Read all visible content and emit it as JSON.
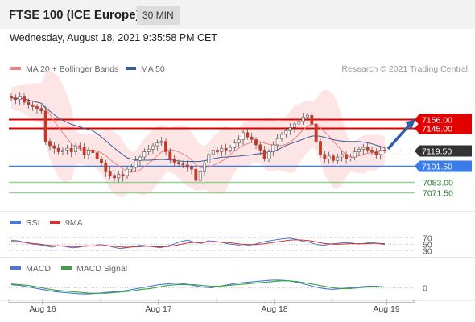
{
  "header": {
    "title": "FTSE 100 (ICE Europe)",
    "timeframe": "30 MIN",
    "datetime": "Wednesday, August 18, 2021 9:35:58 PM CET"
  },
  "legend": {
    "ma20_label": "MA 20 + Bollinger Bands",
    "ma50_label": "MA 50",
    "credit": "Research © 2021 Trading Central",
    "rsi_label": "RSI",
    "rsi_ma_label": "9MA",
    "macd_label": "MACD",
    "macd_signal_label": "MACD Signal"
  },
  "colors": {
    "ma20": "#f08080",
    "ma50": "#3d5a99",
    "bollinger_fill": "#fde0e0",
    "resistance": "#e00000",
    "support_pivot": "#3a7de8",
    "support": "#8fd18f",
    "last_price": "#333333",
    "candle": "#c0392b",
    "arrow": "#2f5fa8",
    "rsi": "#4a78d8",
    "rsi_ma": "#d03030",
    "macd": "#4a78d8",
    "macd_signal": "#3aa53a"
  },
  "chart_data": [
    {
      "type": "line",
      "title": "FTSE 100 (ICE Europe) 30 MIN",
      "x_tick_labels": [
        "Aug 16",
        "Aug 17",
        "Aug 18",
        "Aug 19"
      ],
      "ylim": [
        7050,
        7200
      ],
      "levels": [
        {
          "name": "resistance 2",
          "value": 7156.0,
          "label": "7156.00",
          "color": "#e00000"
        },
        {
          "name": "resistance 1",
          "value": 7145.0,
          "label": "7145.00",
          "color": "#e00000"
        },
        {
          "name": "last",
          "value": 7119.5,
          "label": "7119.50",
          "color": "#333333"
        },
        {
          "name": "pivot",
          "value": 7101.5,
          "label": "7101.50",
          "color": "#3a7de8"
        },
        {
          "name": "support 1",
          "value": 7083.0,
          "label": "7083.00",
          "color": "#8fd18f"
        },
        {
          "name": "support 2",
          "value": 7071.5,
          "label": "7071.50",
          "color": "#8fd18f"
        }
      ],
      "closes": [
        7180,
        7178,
        7182,
        7175,
        7172,
        7170,
        7168,
        7165,
        7130,
        7125,
        7122,
        7118,
        7120,
        7122,
        7118,
        7125,
        7123,
        7115,
        7120,
        7117,
        7110,
        7105,
        7095,
        7090,
        7088,
        7092,
        7090,
        7098,
        7100,
        7108,
        7112,
        7118,
        7121,
        7125,
        7128,
        7130,
        7118,
        7110,
        7106,
        7104,
        7103,
        7100,
        7098,
        7085,
        7095,
        7105,
        7115,
        7120,
        7118,
        7122,
        7120,
        7123,
        7128,
        7132,
        7140,
        7135,
        7132,
        7126,
        7120,
        7110,
        7118,
        7126,
        7133,
        7138,
        7142,
        7146,
        7150,
        7153,
        7158,
        7160,
        7150,
        7130,
        7115,
        7110,
        7113,
        7108,
        7112,
        7115,
        7110,
        7112,
        7118,
        7121,
        7123,
        7120,
        7118,
        7115,
        7120,
        7119.5
      ],
      "series_labels": {
        "ma20": "MA 20 + Bollinger Bands",
        "ma50": "MA 50"
      },
      "forecast_arrow": {
        "from": 7119.5,
        "to": 7156.0
      }
    },
    {
      "type": "line",
      "title": "RSI",
      "ylim": [
        20,
        80
      ],
      "y_ticks": [
        70,
        50,
        30
      ],
      "series": [
        {
          "name": "RSI",
          "values": [
            62,
            60,
            55,
            50,
            48,
            44,
            40,
            45,
            42,
            38,
            40,
            45,
            43,
            48,
            46,
            40,
            36,
            38,
            42,
            46,
            44,
            41,
            38,
            44,
            50,
            58,
            62,
            55,
            52,
            60,
            58,
            55,
            50,
            48,
            44,
            46,
            50,
            56,
            60,
            63,
            66,
            68,
            64,
            58,
            55,
            48,
            46,
            50,
            52,
            54,
            53,
            50,
            52,
            55,
            52,
            48
          ]
        },
        {
          "name": "9MA",
          "values": [
            58,
            57,
            55,
            52,
            50,
            47,
            45,
            44,
            43,
            42,
            42,
            43,
            44,
            44,
            44,
            43,
            41,
            40,
            41,
            42,
            43,
            42,
            41,
            42,
            45,
            49,
            53,
            55,
            55,
            56,
            57,
            56,
            54,
            52,
            49,
            48,
            48,
            50,
            53,
            56,
            59,
            62,
            63,
            62,
            60,
            56,
            52,
            50,
            49,
            50,
            51,
            51,
            51,
            52,
            52,
            51
          ]
        }
      ]
    },
    {
      "type": "line",
      "title": "MACD",
      "y_ticks": [
        0
      ],
      "ylim": [
        -12,
        12
      ],
      "series": [
        {
          "name": "MACD",
          "values": [
            3,
            2,
            0,
            -2,
            -4,
            -6,
            -7,
            -8,
            -9,
            -9,
            -8,
            -7,
            -6,
            -5,
            -3,
            -1,
            1,
            3,
            4,
            5,
            4,
            2,
            0,
            -1,
            1,
            3,
            5,
            6,
            7,
            8,
            9,
            9,
            8,
            6,
            3,
            0,
            -2,
            -3,
            -2,
            -1,
            0,
            1,
            1,
            0
          ]
        },
        {
          "name": "MACD Signal",
          "values": [
            4,
            3,
            2,
            0,
            -2,
            -4,
            -5,
            -6,
            -7,
            -8,
            -8,
            -8,
            -7,
            -6,
            -5,
            -3,
            -2,
            0,
            2,
            3,
            3,
            3,
            2,
            1,
            1,
            2,
            3,
            4,
            5,
            6,
            7,
            8,
            8,
            7,
            5,
            3,
            1,
            -1,
            -2,
            -2,
            -1,
            0,
            0,
            0
          ]
        }
      ]
    }
  ]
}
